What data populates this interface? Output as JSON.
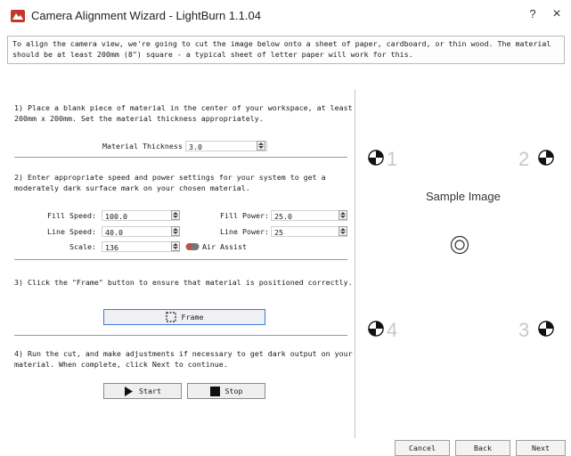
{
  "window": {
    "title": "Camera Alignment Wizard - LightBurn 1.1.04",
    "help_label": "?",
    "close_label": "×"
  },
  "intro": {
    "line1": "To align the camera view, we're going to cut the image below onto a sheet of paper, cardboard, or thin wood.  The material",
    "line2": "should be at least 200mm (8\") square - a typical sheet of letter paper will work for this."
  },
  "step1": {
    "line1": "1) Place a blank piece of material in the center of your workspace, at least",
    "line2": "200mm x 200mm. Set the material thickness appropriately.",
    "thickness_label": "Material Thickness",
    "thickness_value": "3.0"
  },
  "step2": {
    "line1": "2) Enter appropriate speed and power settings for your system to get a",
    "line2": "moderately dark surface mark on your chosen material.",
    "fill_speed_label": "Fill Speed:",
    "fill_speed_value": "100.0",
    "line_speed_label": "Line Speed:",
    "line_speed_value": "40.0",
    "scale_label": "Scale:",
    "scale_value": "136",
    "fill_power_label": "Fill Power:",
    "fill_power_value": "25.0",
    "line_power_label": "Line Power:",
    "line_power_value": "25",
    "air_assist_label": "Air Assist",
    "air_assist_on": false
  },
  "step3": {
    "line1": "3) Click the \"Frame\" button to ensure that material is positioned correctly.",
    "frame_label": "Frame"
  },
  "step4": {
    "line1": "4) Run the cut, and make adjustments if necessary to get dark output on your",
    "line2": "material. When complete, click Next to continue.",
    "start_label": "Start",
    "stop_label": "Stop"
  },
  "sample": {
    "title": "Sample Image",
    "label_1": "1",
    "label_2": "2",
    "label_3": "3",
    "label_4": "4"
  },
  "footer": {
    "cancel_label": "Cancel",
    "back_label": "Back",
    "next_label": "Next"
  },
  "colors": {
    "accent": "#3c7ad6",
    "app_icon": "#c0392b",
    "target_label": "#c8c8c8"
  },
  "icons": {
    "app": "lightburn-logo-icon",
    "target": "registration-target-icon",
    "center": "center-circle-icon",
    "play": "play-icon",
    "stop": "stop-square-icon",
    "frame": "frame-icon",
    "toggle": "toggle-switch-icon",
    "spin": "spinbox-arrows-icon"
  }
}
